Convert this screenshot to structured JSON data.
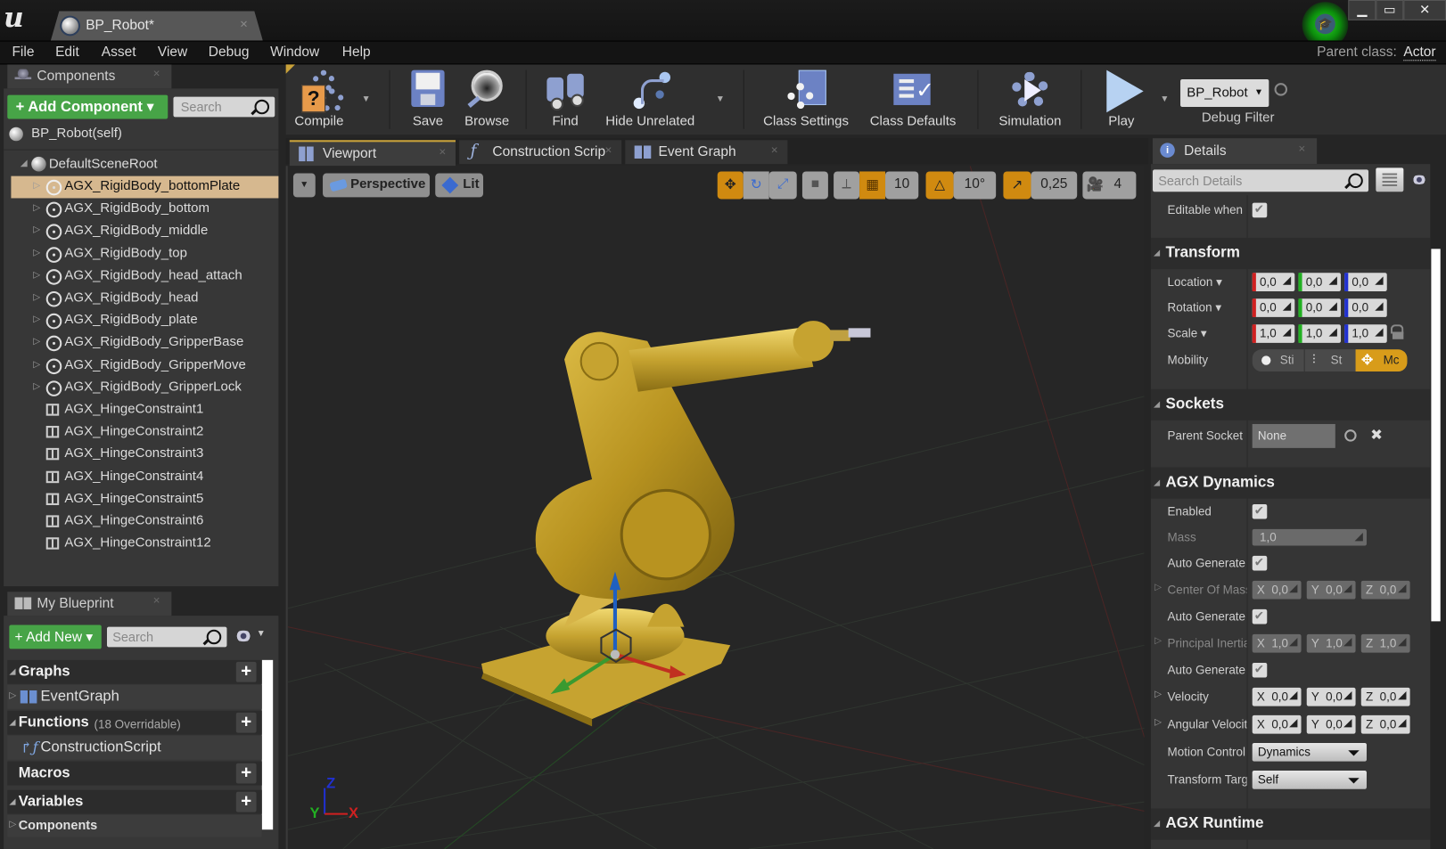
{
  "window": {
    "doc_tab": "BP_Robot*",
    "minimize": "▁",
    "maximize": "▭",
    "close": "✕",
    "parent_class_label": "Parent class:",
    "parent_class_value": "Actor"
  },
  "menu": [
    "File",
    "Edit",
    "Asset",
    "View",
    "Debug",
    "Window",
    "Help"
  ],
  "components": {
    "tab_label": "Components",
    "add_button": "+ Add Component ▾",
    "search_placeholder": "Search",
    "self_label": "BP_Robot(self)",
    "root_label": "DefaultSceneRoot",
    "items": [
      {
        "label": "AGX_RigidBody_bottomPlate",
        "type": "rigidbody",
        "selected": true
      },
      {
        "label": "AGX_RigidBody_bottom",
        "type": "rigidbody"
      },
      {
        "label": "AGX_RigidBody_middle",
        "type": "rigidbody"
      },
      {
        "label": "AGX_RigidBody_top",
        "type": "rigidbody"
      },
      {
        "label": "AGX_RigidBody_head_attach",
        "type": "rigidbody"
      },
      {
        "label": "AGX_RigidBody_head",
        "type": "rigidbody"
      },
      {
        "label": "AGX_RigidBody_plate",
        "type": "rigidbody"
      },
      {
        "label": "AGX_RigidBody_GripperBase",
        "type": "rigidbody"
      },
      {
        "label": "AGX_RigidBody_GripperMove",
        "type": "rigidbody"
      },
      {
        "label": "AGX_RigidBody_GripperLock",
        "type": "rigidbody"
      },
      {
        "label": "AGX_HingeConstraint1",
        "type": "hinge"
      },
      {
        "label": "AGX_HingeConstraint2",
        "type": "hinge"
      },
      {
        "label": "AGX_HingeConstraint3",
        "type": "hinge"
      },
      {
        "label": "AGX_HingeConstraint4",
        "type": "hinge"
      },
      {
        "label": "AGX_HingeConstraint5",
        "type": "hinge"
      },
      {
        "label": "AGX_HingeConstraint6",
        "type": "hinge"
      },
      {
        "label": "AGX_HingeConstraint12",
        "type": "hinge"
      }
    ]
  },
  "my_blueprint": {
    "tab_label": "My Blueprint",
    "add_button": "+ Add New ▾",
    "search_placeholder": "Search",
    "graphs": "Graphs",
    "event_graph": "EventGraph",
    "functions": "Functions",
    "functions_note": "(18 Overridable)",
    "construction_script": "ConstructionScript",
    "macros": "Macros",
    "variables": "Variables",
    "components": "Components"
  },
  "toolbar": {
    "compile": "Compile",
    "save": "Save",
    "browse": "Browse",
    "find": "Find",
    "hide_unrelated": "Hide Unrelated",
    "class_settings": "Class Settings",
    "class_defaults": "Class Defaults",
    "simulation": "Simulation",
    "play": "Play",
    "debug_object": "BP_Robot",
    "debug_filter": "Debug Filter"
  },
  "editor_tabs": [
    "Viewport",
    "Construction Scrip",
    "Event Graph"
  ],
  "viewport": {
    "perspective": "Perspective",
    "lit": "Lit",
    "grid_snap": "10",
    "rotation_snap": "10°",
    "scale_snap": "0,25",
    "camera_speed": "4",
    "axis_x": "X",
    "axis_y": "Y",
    "axis_z": "Z",
    "colors": {
      "x": "#d02020",
      "y": "#22b022",
      "z": "#2030d0",
      "accent": "#d08a10"
    }
  },
  "details": {
    "tab_label": "Details",
    "search_placeholder": "Search Details",
    "editable_when_inherited": "Editable when Ir",
    "transform": {
      "title": "Transform",
      "location_label": "Location ▾",
      "location": [
        "0,0",
        "0,0",
        "0,0"
      ],
      "rotation_label": "Rotation ▾",
      "rotation": [
        "0,0",
        "0,0",
        "0,0"
      ],
      "scale_label": "Scale ▾",
      "scale": [
        "1,0",
        "1,0",
        "1,0"
      ],
      "mobility_label": "Mobility",
      "mobility_options": [
        "Sti",
        "St",
        "Mc"
      ],
      "mobility_selected": "Movable"
    },
    "sockets": {
      "title": "Sockets",
      "parent_socket_label": "Parent Socket",
      "parent_socket_value": "None"
    },
    "agx_dynamics": {
      "title": "AGX Dynamics",
      "enabled_label": "Enabled",
      "mass_label": "Mass",
      "mass_value": "1,0",
      "auto_mass_label": "Auto Generate M",
      "center_of_mass_label": "Center Of Mass",
      "center_of_mass": [
        "X  0,0",
        "Y  0,0",
        "Z  0,0"
      ],
      "auto_com_label": "Auto Generate C",
      "principal_inertia_label": "Principal Inertia",
      "principal_inertia": [
        "X  1,0",
        "Y  1,0",
        "Z  1,0"
      ],
      "auto_pi_label": "Auto Generate P",
      "velocity_label": "Velocity",
      "velocity": [
        "X  0,0",
        "Y  0,0",
        "Z  0,0"
      ],
      "angular_velocity_label": "Angular Velocit",
      "angular_velocity": [
        "X  0,0",
        "Y  0,0",
        "Z  0,0"
      ],
      "motion_control_label": "Motion Control",
      "motion_control_value": "Dynamics",
      "transform_target_label": "Transform Targ",
      "transform_target_value": "Self"
    },
    "agx_runtime": {
      "title": "AGX Runtime"
    }
  }
}
